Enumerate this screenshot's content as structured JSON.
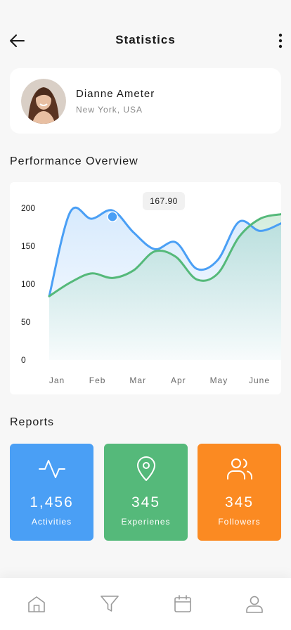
{
  "header": {
    "title": "Statistics",
    "back_icon": "arrow-left-icon",
    "more_icon": "more-vertical-icon"
  },
  "profile": {
    "name": "Dianne Ameter",
    "location": "New York, USA"
  },
  "performance": {
    "title": "Performance Overview",
    "tooltip_value": "167.90"
  },
  "chart_data": {
    "type": "area",
    "categories": [
      "Jan",
      "Feb",
      "Mar",
      "Apr",
      "May",
      "June"
    ],
    "ylim": [
      0,
      200
    ],
    "yticks": [
      "200",
      "150",
      "100",
      "50",
      "0"
    ],
    "grid": false,
    "series": [
      {
        "color": "#4a9ff5",
        "values": [
          84,
          195,
          186,
          197,
          168,
          146,
          155,
          120,
          132,
          182,
          170,
          180
        ]
      },
      {
        "color": "#55b97a",
        "values": [
          84,
          102,
          114,
          108,
          118,
          143,
          136,
          106,
          114,
          162,
          186,
          192
        ]
      }
    ],
    "highlight": {
      "category": "Mar",
      "value": 167.9
    }
  },
  "reports": {
    "title": "Reports",
    "tiles": [
      {
        "value": "1,456",
        "label": "Activities",
        "icon": "activity-icon",
        "color": "#4a9ff5"
      },
      {
        "value": "345",
        "label": "Experienes",
        "icon": "map-pin-icon",
        "color": "#55b97a"
      },
      {
        "value": "345",
        "label": "Followers",
        "icon": "users-icon",
        "color": "#fb8a22"
      }
    ]
  },
  "nav": {
    "items": [
      "home-icon",
      "filter-icon",
      "calendar-icon",
      "user-icon"
    ]
  }
}
